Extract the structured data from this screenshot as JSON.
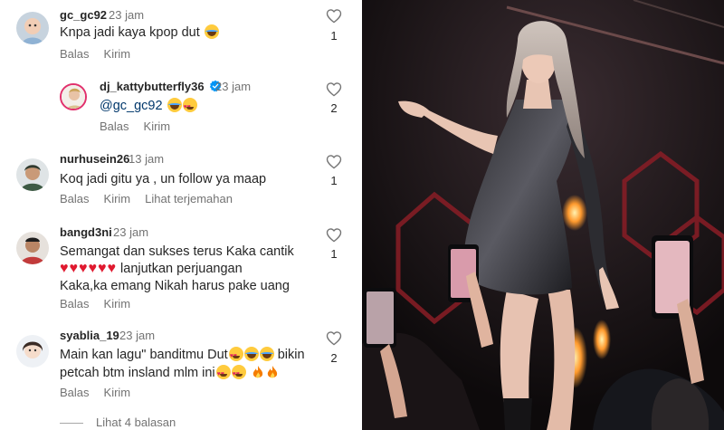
{
  "comments": [
    {
      "username": "gc_gc92",
      "time": "23 jam",
      "text": "Knpa jadi kaya kpop dut",
      "emoji": [
        "laugh-emoji"
      ],
      "likes": "1",
      "reply_label": "Balas",
      "send_label": "Kirim"
    },
    {
      "username": "dj_kattybutterfly36",
      "verified": true,
      "time": "23 jam",
      "mention": "@gc_gc92",
      "emoji": [
        "laugh-emoji",
        "heart-eyes-emoji"
      ],
      "likes": "2",
      "reply_label": "Balas",
      "send_label": "Kirim"
    },
    {
      "username": "nurhusein26",
      "time": "13 jam",
      "text": "Koq jadi gitu ya , un follow ya maap",
      "likes": "1",
      "reply_label": "Balas",
      "send_label": "Kirim",
      "translate_label": "Lihat terjemahan"
    },
    {
      "username": "bangd3ni",
      "time": "23 jam",
      "lines": [
        "Semangat dan sukses terus Kaka cantik",
        "lanjutkan perjuangan",
        "Kaka,ka emang Nikah harus pake uang"
      ],
      "emoji": [
        "red-heart",
        "red-heart",
        "red-heart",
        "red-heart",
        "red-heart",
        "red-heart"
      ],
      "likes": "1",
      "reply_label": "Balas",
      "send_label": "Kirim"
    },
    {
      "username": "syablia_19",
      "time": "23 jam",
      "lines": [
        "Main kan lagu\" banditmu Dut",
        "bikin",
        "petcah btm insland mlm ini"
      ],
      "emoji": [
        "heart-eyes-emoji",
        "laugh-emoji",
        "laugh-emoji",
        "heart-eyes-emoji",
        "heart-eyes-emoji",
        "fire-emoji",
        "fire-emoji"
      ],
      "likes": "2",
      "reply_label": "Balas",
      "send_label": "Kirim"
    }
  ],
  "view_replies": "Lihat 4 balasan",
  "icons": {
    "like": "heart-outline-icon",
    "verified": "verified-badge-icon"
  },
  "colors": {
    "text": "#262626",
    "secondary": "#737373",
    "verified": "#0095f6",
    "mention": "#00376b",
    "photo_background": "#120e10"
  }
}
